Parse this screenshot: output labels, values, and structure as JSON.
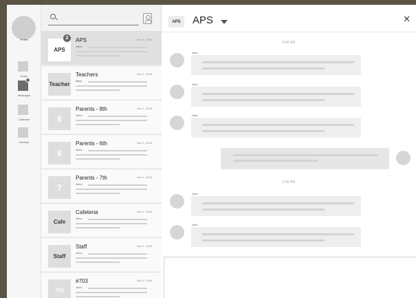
{
  "rail": {
    "profile_label": "Profile",
    "nav": [
      {
        "label": "Home"
      },
      {
        "label": "Messages"
      },
      {
        "label": "Calendar"
      },
      {
        "label": "Devices"
      }
    ]
  },
  "threads": [
    {
      "name": "APS",
      "thumb": "APS",
      "date": "Nov 1, 2018",
      "sender": "John:",
      "badge": "2"
    },
    {
      "name": "Teachers",
      "thumb": "Teacher",
      "date": "Nov 1, 2018",
      "sender": "Mary:"
    },
    {
      "name": "Parents - 8th",
      "thumb": "8",
      "date": "Nov 1, 2018",
      "sender": "John:"
    },
    {
      "name": "Parents - 6th",
      "thumb": "6",
      "date": "Nov 1, 2018",
      "sender": "John:"
    },
    {
      "name": "Parents - 7th",
      "thumb": "7",
      "date": "Nov 1, 2018",
      "sender": "John:"
    },
    {
      "name": "Cafeteria",
      "thumb": "Cafe",
      "date": "Nov 1, 2018",
      "sender": "John:"
    },
    {
      "name": "Staff",
      "thumb": "Staff",
      "date": "Nov 1, 2018",
      "sender": "John:"
    },
    {
      "name": "#703",
      "thumb": "703",
      "date": "Nov 1, 2018",
      "sender": "John:"
    }
  ],
  "chat": {
    "thumb": "APS",
    "title": "APS",
    "close": "✕",
    "timestamps": [
      "8:40 AM",
      "2:30 PM"
    ],
    "messages": [
      {
        "sender": "John"
      },
      {
        "sender": "John"
      },
      {
        "sender": "John"
      },
      {
        "sender": ""
      },
      {
        "sender": "John"
      },
      {
        "sender": "John"
      }
    ]
  }
}
